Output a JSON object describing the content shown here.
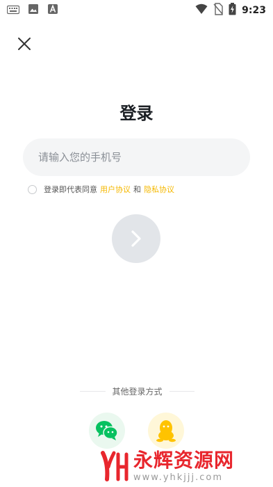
{
  "status_bar": {
    "time": "9:23",
    "left_icons": [
      "keyboard-icon",
      "image-icon",
      "app-a-icon"
    ],
    "right_icons": [
      "wifi-icon",
      "no-sim-icon",
      "battery-charging-icon"
    ]
  },
  "header": {
    "close_icon": "close-icon"
  },
  "login": {
    "title": "登录",
    "phone_placeholder": "请输入您的手机号",
    "phone_value": "",
    "agreement_prefix": "登录即代表同意",
    "user_agreement": "用户协议",
    "and": "和",
    "privacy_policy": "隐私协议",
    "agreement_checked": false,
    "next_icon": "chevron-right-icon"
  },
  "other_login": {
    "label": "其他登录方式",
    "options": [
      {
        "name": "wechat",
        "icon": "wechat-icon"
      },
      {
        "name": "qq",
        "icon": "qq-icon"
      }
    ]
  },
  "watermark": {
    "title": "永辉资源网",
    "url": "www.yhkjjj.com"
  },
  "colors": {
    "accent_link": "#f5b800",
    "next_button_disabled": "#e2e5e9",
    "input_bg": "#f4f5f6",
    "wechat_green": "#07c160",
    "qq_yellow": "#ffc300",
    "watermark_red": "#e8262d"
  }
}
